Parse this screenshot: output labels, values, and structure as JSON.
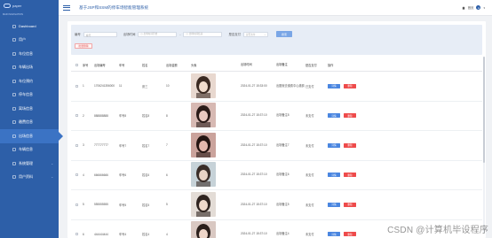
{
  "app": {
    "logo_text": "paper",
    "title": "基于JSP和SSM的停车场智能管理系统"
  },
  "sidebar": {
    "section_label": "MAIN NAVIGATION",
    "items": [
      {
        "label": "Dashboard",
        "icon": "dashboard-icon"
      },
      {
        "label": "用户",
        "icon": "user-icon"
      },
      {
        "label": "车位信息",
        "icon": "parking-icon"
      },
      {
        "label": "车辆出场",
        "icon": "car-exit-icon"
      },
      {
        "label": "车位预约",
        "icon": "reserve-icon"
      },
      {
        "label": "停车信息",
        "icon": "parking-info-icon"
      },
      {
        "label": "离场信息",
        "icon": "leave-icon"
      },
      {
        "label": "缴费信息",
        "icon": "pay-icon"
      },
      {
        "label": "出场信息",
        "icon": "exit-info-icon",
        "active": true
      },
      {
        "label": "车辆信息",
        "icon": "vehicle-icon"
      },
      {
        "label": "系统管理",
        "icon": "system-icon",
        "has_children": true
      },
      {
        "label": "用户资料",
        "icon": "profile-icon",
        "has_children": true
      }
    ]
  },
  "header": {
    "home_label": "首页",
    "avatar_letter": "A"
  },
  "filter": {
    "code_label": "编号",
    "code_placeholder": "编号",
    "time_label": "出场时间",
    "date_start_placeholder": "出场时间开始",
    "date_end_placeholder": "出场时间结束",
    "pay_label": "是否支付",
    "pay_placeholder": "是否支付",
    "search_label": "搜索",
    "batch_delete_label": "批量删除"
  },
  "table": {
    "headers": [
      "序号",
      "出场编号",
      "车号",
      "姓名",
      "出场金额",
      "头像",
      "出场时间",
      "出场备注",
      "是否支付",
      "操作"
    ],
    "detail_label": "详情",
    "delete_label": "删除",
    "rows": [
      {
        "no": "1",
        "code": "1706241356000",
        "car": "11",
        "name": "张三",
        "amount": "10",
        "time": "2024-01-27 15:33:00",
        "note": "出图就去缴费中心缴费",
        "paid": "已支付"
      },
      {
        "no": "2",
        "code": "888888888",
        "car": "车号8",
        "name": "姓名8",
        "amount": "8",
        "time": "2024-01-27 15:37:10",
        "note": "出场备注8",
        "paid": "未支付"
      },
      {
        "no": "3",
        "code": "777777777",
        "car": "车号7",
        "name": "姓名7",
        "amount": "7",
        "time": "2024-01-27 15:37:10",
        "note": "出场备注7",
        "paid": "未支付"
      },
      {
        "no": "4",
        "code": "666666666",
        "car": "车号6",
        "name": "姓名6",
        "amount": "6",
        "time": "2024-01-27 15:37:10",
        "note": "出场备注6",
        "paid": "未支付"
      },
      {
        "no": "5",
        "code": "555555555",
        "car": "车号5",
        "name": "姓名5",
        "amount": "5",
        "time": "2024-01-27 15:37:10",
        "note": "出场备注5",
        "paid": "未支付"
      },
      {
        "no": "6",
        "code": "444444444",
        "car": "车号4",
        "name": "姓名4",
        "amount": "4",
        "time": "2024-01-27 15:37:10",
        "note": "出场备注4",
        "paid": "未支付"
      }
    ]
  },
  "watermark": "CSDN @计算机毕设程序"
}
